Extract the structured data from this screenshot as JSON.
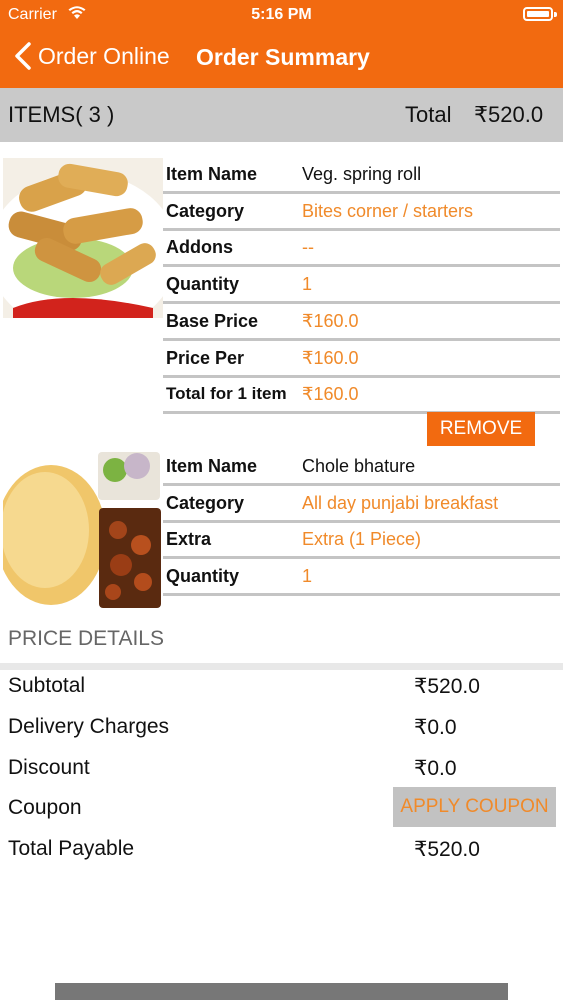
{
  "status": {
    "carrier": "Carrier",
    "time": "5:16 PM"
  },
  "nav": {
    "back_label": "Order Online",
    "title": "Order Summary"
  },
  "summary": {
    "items_count": "ITEMS( 3 )",
    "total_label": "Total",
    "total_value": "₹520.0"
  },
  "items": [
    {
      "image": "spring-roll-photo",
      "rows": [
        {
          "key": "Item Name",
          "value": "Veg. spring roll"
        },
        {
          "key": "Category",
          "value": "Bites corner / starters"
        },
        {
          "key": "Addons",
          "value": " --"
        },
        {
          "key": "Quantity",
          "value": "1"
        },
        {
          "key": "Base Price",
          "value": "₹160.0"
        },
        {
          "key": "Price Per",
          "value": "₹160.0"
        },
        {
          "key": "Total for 1 item",
          "value": "₹160.0"
        }
      ],
      "remove_label": "REMOVE"
    },
    {
      "image": "chole-bhature-photo",
      "rows": [
        {
          "key": "Item Name",
          "value": "Chole bhature"
        },
        {
          "key": "Category",
          "value": "All day punjabi breakfast"
        },
        {
          "key": "Extra",
          "value": "Extra (1 Piece)"
        },
        {
          "key": "Quantity",
          "value": "1"
        }
      ]
    }
  ],
  "price_details": {
    "header": "PRICE DETAILS",
    "subtotal_label": "Subtotal",
    "subtotal_value": "₹520.0",
    "delivery_label": "Delivery Charges",
    "delivery_value": "₹0.0",
    "discount_label": "Discount",
    "discount_value": "₹0.0",
    "coupon_label": "Coupon",
    "coupon_button": "APPLY COUPON",
    "payable_label": "Total Payable",
    "payable_value": "₹520.0"
  },
  "colors": {
    "brand": "#f26a10",
    "accent_text": "#f08a2a",
    "bar_gray": "#c9c9c9"
  }
}
